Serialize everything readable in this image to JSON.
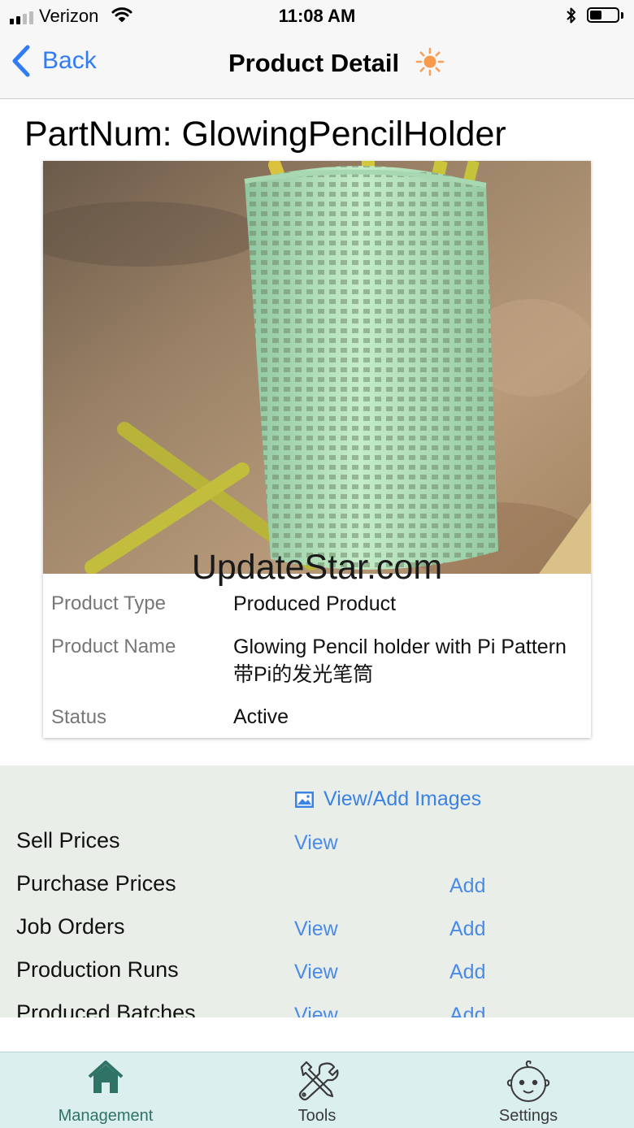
{
  "status_bar": {
    "carrier": "Verizon",
    "time": "11:08 AM",
    "signal_bars_filled": 2,
    "signal_bars_total": 4,
    "battery_level": 0.45
  },
  "nav": {
    "back_label": "Back",
    "title": "Product Detail",
    "title_icon": "sun-icon"
  },
  "product": {
    "heading": "PartNum: GlowingPencilHolder",
    "image_watermark": "UpdateStar.com",
    "fields": [
      {
        "label": "Product Type",
        "value": "Produced Product"
      },
      {
        "label": "Product Name",
        "value": "Glowing Pencil holder with Pi Pattern 带Pi的发光笔筒"
      },
      {
        "label": "Status",
        "value": "Active"
      }
    ]
  },
  "actions": {
    "images_link": "View/Add Images",
    "rows": [
      {
        "label": "Sell Prices",
        "view": "View",
        "add": ""
      },
      {
        "label": "Purchase Prices",
        "view": "",
        "add": "Add"
      },
      {
        "label": "Job Orders",
        "view": "View",
        "add": "Add"
      },
      {
        "label": "Production Runs",
        "view": "View",
        "add": "Add"
      },
      {
        "label": "Produced Batches",
        "view": "View",
        "add": "Add"
      }
    ]
  },
  "tabs": [
    {
      "label": "Management",
      "icon": "house-icon",
      "active": true
    },
    {
      "label": "Tools",
      "icon": "tools-icon",
      "active": false
    },
    {
      "label": "Settings",
      "icon": "baby-face-icon",
      "active": false
    }
  ],
  "colors": {
    "link_blue": "#4a8ae8",
    "back_blue": "#2f7cf6",
    "tab_active": "#2e7366",
    "actions_bg": "#e9efe8",
    "tab_bar_bg": "#dcefef"
  }
}
